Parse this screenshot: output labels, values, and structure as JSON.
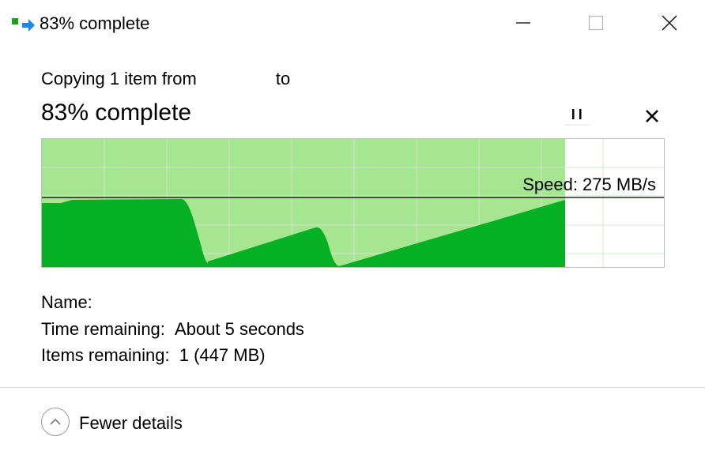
{
  "window": {
    "title": "83% complete",
    "icon": "copy-transfer-icon",
    "controls": [
      "minimize-icon",
      "maximize-icon",
      "close-icon"
    ]
  },
  "header": {
    "copy_prefix": "Copying 1 item from",
    "copy_to": "to",
    "progress_title": "83% complete",
    "progress_percent": 83
  },
  "actions": {
    "pause_icon": "pause-icon",
    "cancel_icon": "cancel-icon"
  },
  "graph": {
    "speed_label": "Speed: 275 MB/s",
    "colors": {
      "progress_fill": "#a6e690",
      "speed_fill": "#06b025",
      "grid": "#cfe8cf",
      "border": "#bcbcbc"
    }
  },
  "details": {
    "name_label": "Name:",
    "name_value": "",
    "time_label": "Time remaining:",
    "time_value": "About 5 seconds",
    "items_label": "Items remaining:",
    "items_value": "1 (447 MB)"
  },
  "footer": {
    "toggle_label": "Fewer details",
    "toggle_icon": "chevron-up-icon"
  }
}
